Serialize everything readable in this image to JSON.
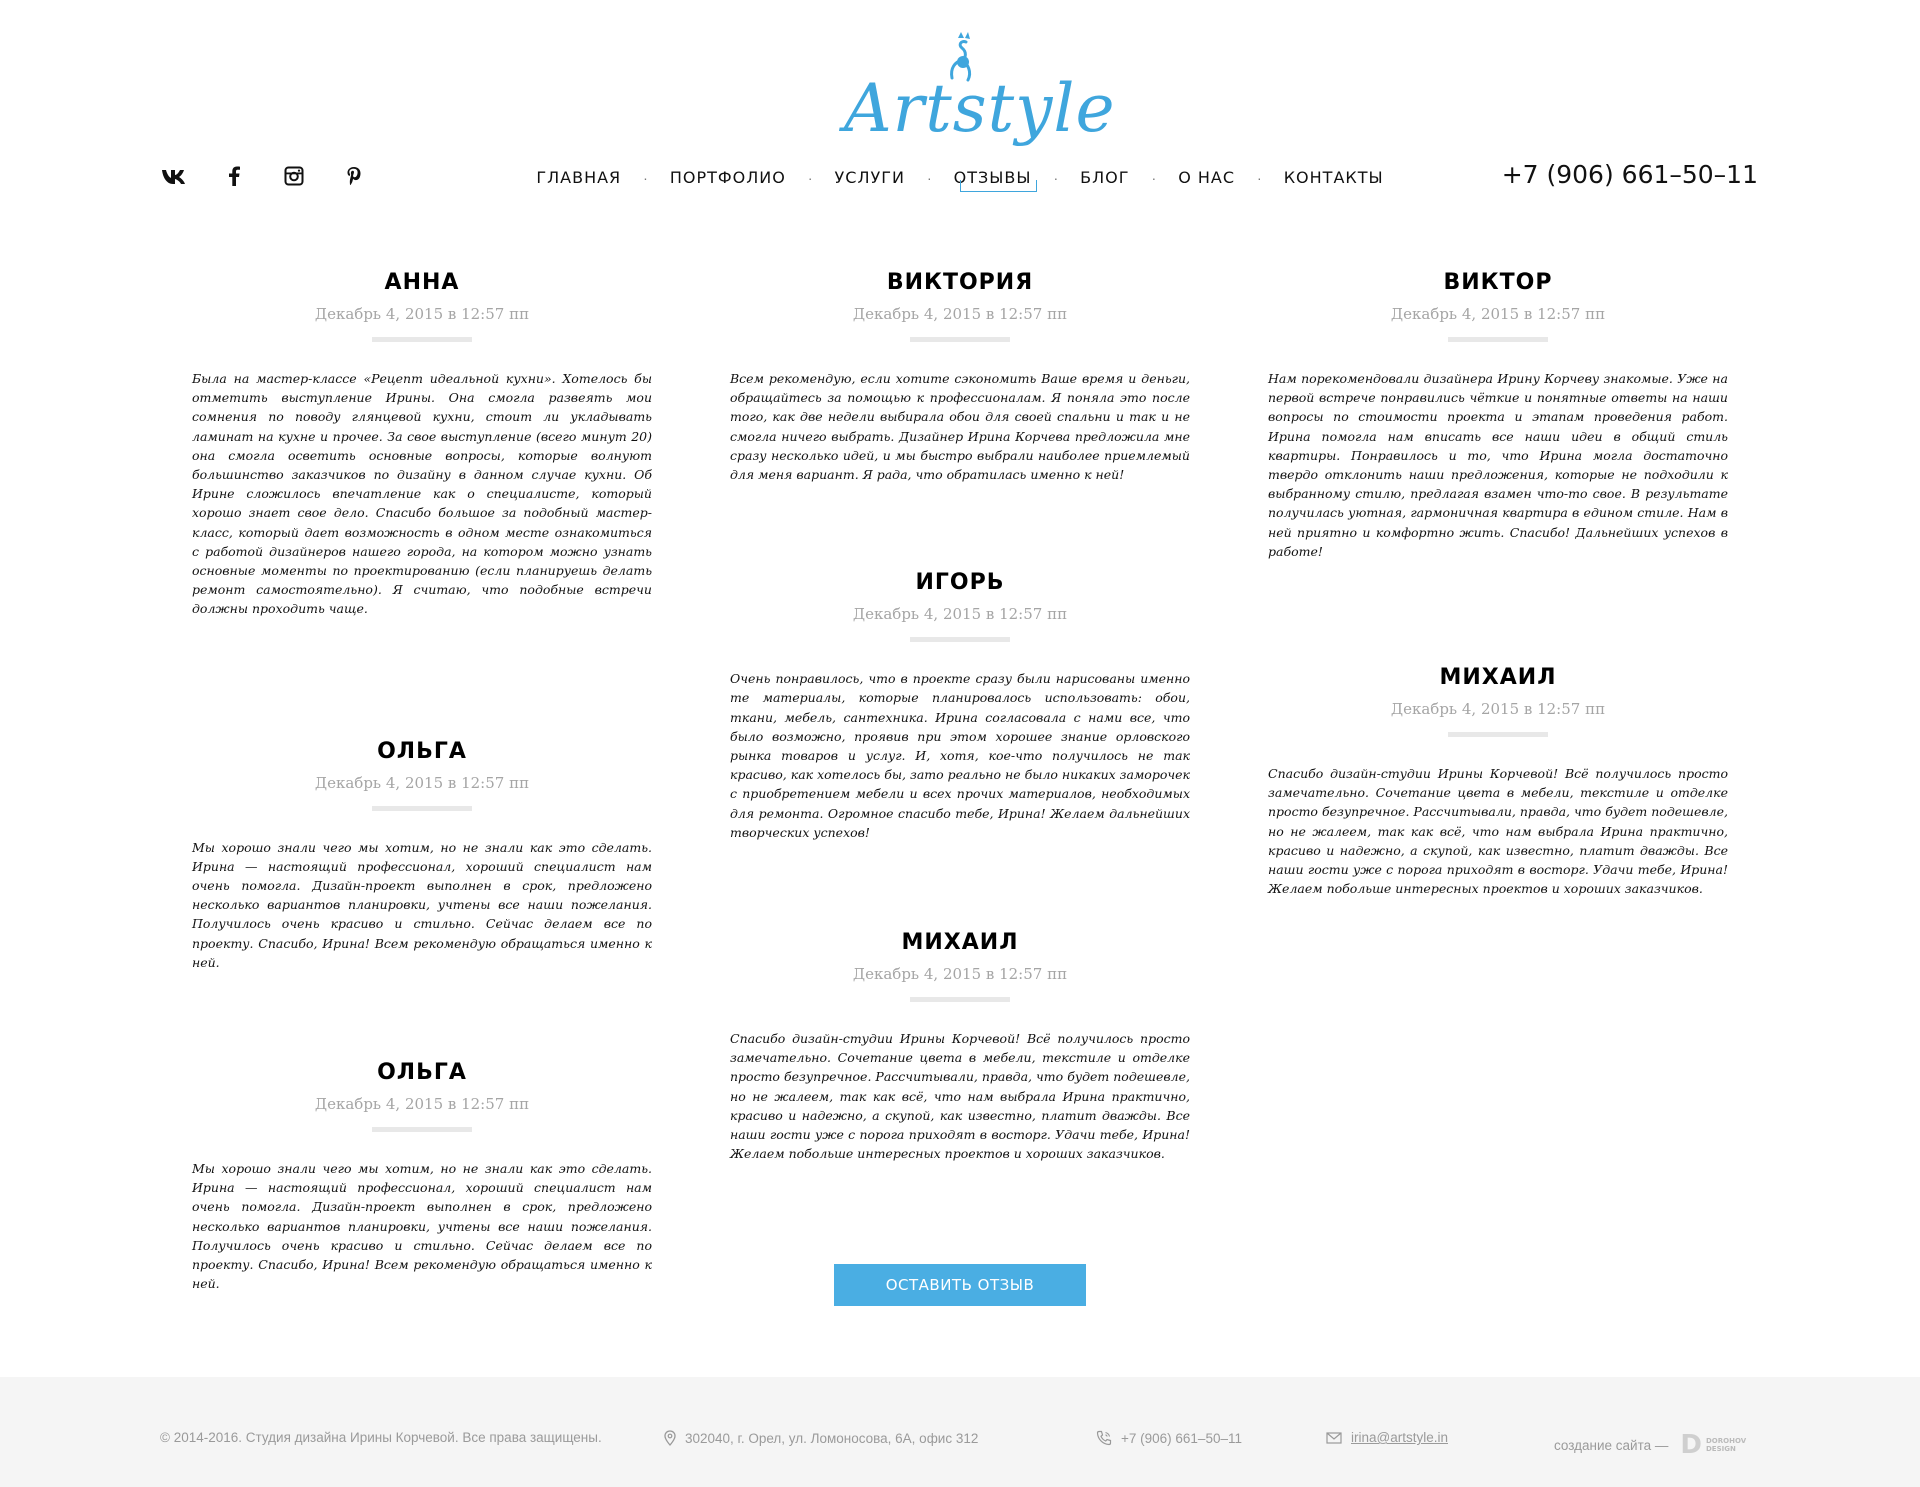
{
  "header": {
    "logo_text": "Artstyle",
    "phone": "+7 (906) 661–50–11",
    "social": [
      "vk-icon",
      "facebook-icon",
      "instagram-icon",
      "pinterest-icon"
    ],
    "nav": [
      {
        "label": "ГЛАВНАЯ"
      },
      {
        "label": "ПОРТФОЛИО"
      },
      {
        "label": "УСЛУГИ"
      },
      {
        "label": "ОТЗЫВЫ",
        "active": true
      },
      {
        "label": "БЛОГ"
      },
      {
        "label": "О НАС"
      },
      {
        "label": "КОНТАКТЫ"
      }
    ]
  },
  "reviews": {
    "left": [
      {
        "name": "АННА",
        "date": "Декабрь 4, 2015 в 12:57 пп",
        "text": "Была на мастер-классе «Рецепт идеальной кухни». Хотелось бы отметить выступление Ирины. Она смогла развеять мои сомнения по поводу глянцевой кухни, стоит ли укладывать ламинат на кухне и прочее. За свое выступление (всего минут 20) она смогла осветить основные вопросы, которые волнуют большинство заказчиков по дизайну в данном случае кухни. Об Ирине сложилось впечатление как о специалисте, который хорошо знает свое дело. Спасибо большое за подобный мастер-класс, который дает возможность в одном месте ознакомиться с работой дизайнеров нашего города, на котором можно узнать основные моменты по проектированию (если планируешь делать ремонт самостоятельно). Я считаю, что подобные встречи должны проходить чаще."
      },
      {
        "name": "ОЛЬГА",
        "date": "Декабрь 4, 2015 в 12:57 пп",
        "text": "Мы хорошо знали чего мы хотим, но не знали как это сделать. Ирина — настоящий профессионал, хороший специалист нам очень помогла. Дизайн-проект выполнен в срок, предложено несколько вариантов планировки, учтены все наши пожелания. Получилось очень красиво и стильно. Сейчас делаем все по проекту. Спасибо, Ирина! Всем рекомендую обращаться именно к ней."
      },
      {
        "name": "ОЛЬГА",
        "date": "Декабрь 4, 2015 в 12:57 пп",
        "text": "Мы хорошо знали чего мы хотим, но не знали как это сделать. Ирина — настоящий профессионал, хороший специалист нам очень помогла. Дизайн-проект выполнен в срок, предложено несколько вариантов планировки, учтены все наши пожелания. Получилось очень красиво и стильно. Сейчас делаем все по проекту. Спасибо, Ирина! Всем рекомендую обращаться именно к ней."
      }
    ],
    "middle": [
      {
        "name": "ВИКТОРИЯ",
        "date": "Декабрь 4, 2015 в 12:57 пп",
        "text": "Всем рекомендую, если хотите сэкономить Ваше время и деньги, обращайтесь за помощью к профессионалам. Я поняла это после того, как две недели выбирала обои для своей спальни и так и не смогла ничего выбрать. Дизайнер Ирина Корчева предложила мне сразу несколько идей, и мы быстро выбрали наиболее приемлемый для меня вариант. Я рада, что обратилась именно к ней!"
      },
      {
        "name": "ИГОРЬ",
        "date": "Декабрь 4, 2015 в 12:57 пп",
        "text": "Очень понравилось, что в проекте сразу были нарисованы именно те материалы, которые планировалось использовать: обои, ткани, мебель, сантехника. Ирина согласовала с нами все, что было возможно, проявив при этом хорошее знание орловского рынка товаров и услуг. И, хотя, кое-что получилось не так красиво, как хотелось бы, зато реально не было никаких заморочек с приобретением мебели и всех прочих материалов, необходимых для ремонта. Огромное спасибо тебе, Ирина! Желаем дальнейших творческих успехов!"
      },
      {
        "name": "МИХАИЛ",
        "date": "Декабрь 4, 2015 в 12:57 пп",
        "text": "Спасибо дизайн-студии Ирины Корчевой! Всё получилось просто замечательно. Сочетание цвета в мебели, текстиле и отделке просто безупречное. Рассчитывали, правда, что будет подешевле, но не жалеем, так как всё, что нам выбрала Ирина практично, красиво и надежно, а скупой, как известно, платит дважды. Все наши гости уже с порога приходят в восторг. Удачи тебе, Ирина! Желаем побольше интересных проектов и хороших заказчиков."
      }
    ],
    "right": [
      {
        "name": "ВИКТОР",
        "date": "Декабрь 4, 2015 в 12:57 пп",
        "text": "Нам порекомендовали дизайнера Ирину Корчеву знакомые. Уже на первой встрече понравились чёткие и понятные ответы на наши вопросы по стоимости проекта и этапам проведения работ. Ирина помогла нам вписать все наши идеи в общий стиль квартиры. Понравилось и то, что Ирина могла достаточно твердо отклонить наши предложения, которые не подходили к выбранному стилю, предлагая взамен что-то свое. В результате получилась уютная, гармоничная квартира в едином стиле. Нам в ней приятно и комфортно жить. Спасибо! Дальнейших успехов в работе!"
      },
      {
        "name": "МИХАИЛ",
        "date": "Декабрь 4, 2015 в 12:57 пп",
        "text": "Спасибо дизайн-студии Ирины Корчевой! Всё получилось просто замечательно. Сочетание цвета в мебели, текстиле и отделке просто безупречное. Рассчитывали, правда, что будет подешевле, но не жалеем, так как всё, что нам выбрала Ирина практично, красиво и надежно, а скупой, как известно, платит дважды. Все наши гости уже с порога приходят в восторг. Удачи тебе, Ирина! Желаем побольше интересных проектов и хороших заказчиков."
      }
    ]
  },
  "button": {
    "label": "ОСТАВИТЬ ОТЗЫВ"
  },
  "footer": {
    "copyright": "© 2014-2016. Студия дизайна Ирины Корчевой. Все права защищены.",
    "address": "302040, г. Орел, ул. Ломоносова, 6А, офис 312",
    "phone": "+7 (906) 661–50–11",
    "email": "irina@artstyle.in",
    "made_by": "создание сайта —",
    "maker_line1": "DOROHOV",
    "maker_line2": "DESIGN"
  },
  "colors": {
    "accent": "#4aaee3",
    "logo": "#3fa6dd",
    "footer_bg": "#f5f5f5"
  }
}
